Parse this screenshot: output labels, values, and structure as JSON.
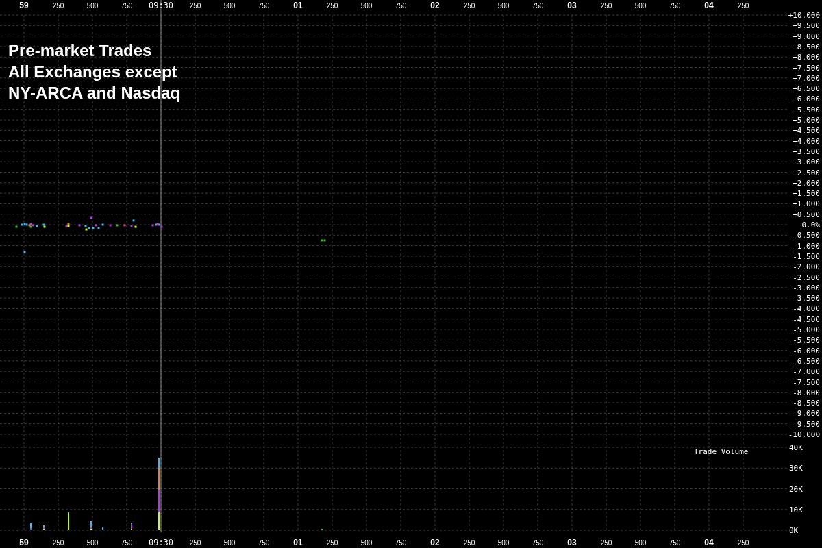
{
  "caption": [
    "Pre-market Trades",
    "All Exchanges except",
    "NY-ARCA and Nasdaq"
  ],
  "price_chart": {
    "time_labels": [
      "59",
      "09:30",
      "250",
      "500",
      "750",
      "01",
      "250",
      "500",
      "750",
      "02",
      "250",
      "500",
      "750",
      "03",
      "250",
      "500",
      "750",
      "04",
      "250"
    ],
    "chart_data": {
      "type": "scatter",
      "grid": true,
      "xlim": [
        -175,
        5575
      ],
      "ylim": [
        -10,
        10
      ],
      "xticks": [
        250,
        500,
        750
      ],
      "yticks": [
        {
          "value": 10,
          "label": "+10.000"
        },
        {
          "value": 9.5,
          "label": "+9.500"
        },
        {
          "value": 9,
          "label": "+9.000"
        },
        {
          "value": 8.5,
          "label": "+8.500"
        },
        {
          "value": 8,
          "label": "+8.000"
        },
        {
          "value": 7.5,
          "label": "+7.500"
        },
        {
          "value": 7,
          "label": "+7.000"
        },
        {
          "value": 6.5,
          "label": "+6.500"
        },
        {
          "value": 6,
          "label": "+6.000"
        },
        {
          "value": 5.5,
          "label": "+5.500"
        },
        {
          "value": 5,
          "label": "+5.000"
        },
        {
          "value": 4.5,
          "label": "+4.500"
        },
        {
          "value": 4,
          "label": "+4.000"
        },
        {
          "value": 3.5,
          "label": "+3.500"
        },
        {
          "value": 3,
          "label": "+3.000"
        },
        {
          "value": 2.5,
          "label": "+2.500"
        },
        {
          "value": 2,
          "label": "+2.000"
        },
        {
          "value": 1.5,
          "label": "+1.500"
        },
        {
          "value": 1,
          "label": "+1.000"
        },
        {
          "value": 0.5,
          "label": "+0.500"
        },
        {
          "value": 0,
          "label": "0.0%"
        },
        {
          "value": -0.5,
          "label": "-0.500"
        },
        {
          "value": -1,
          "label": "-1.000"
        },
        {
          "value": -1.5,
          "label": "-1.500"
        },
        {
          "value": -2,
          "label": "-2.000"
        },
        {
          "value": -2.5,
          "label": "-2.500"
        },
        {
          "value": -3,
          "label": "-3.000"
        },
        {
          "value": -3.5,
          "label": "-3.500"
        },
        {
          "value": -4,
          "label": "-4.000"
        },
        {
          "value": -4.5,
          "label": "-4.500"
        },
        {
          "value": -5,
          "label": "-5.000"
        },
        {
          "value": -5.5,
          "label": "-5.500"
        },
        {
          "value": -6,
          "label": "-6.000"
        },
        {
          "value": -6.5,
          "label": "-6.500"
        },
        {
          "value": -7,
          "label": "-7.000"
        },
        {
          "value": -7.5,
          "label": "-7.500"
        },
        {
          "value": -8,
          "label": "-8.000"
        },
        {
          "value": -8.5,
          "label": "-8.500"
        },
        {
          "value": -9,
          "label": "-9.000"
        },
        {
          "value": -9.5,
          "label": "-9.500"
        },
        {
          "value": -10,
          "label": "-10.000"
        }
      ],
      "series": [
        {
          "color": "#33bbee",
          "x": [
            -15,
            5,
            20,
            95,
            145,
            450,
            475,
            505,
            545,
            575,
            800,
            965,
            985,
            5
          ],
          "values": [
            0,
            0.03,
            0,
            -0.07,
            0,
            -0.07,
            -0.16,
            -0.16,
            -0.16,
            0,
            0.2,
            0,
            0,
            -1.31
          ]
        },
        {
          "color": "#bb33ee",
          "x": [
            50,
            65,
            310,
            405,
            490,
            525,
            630,
            785,
            940,
            1005
          ],
          "values": [
            0.03,
            -0.03,
            -0.07,
            -0.03,
            0.33,
            -0.03,
            -0.03,
            -0.07,
            -0.03,
            -0.1
          ]
        },
        {
          "color": "#ccff00",
          "x": [
            150,
            325,
            455,
            815
          ],
          "values": [
            -0.1,
            -0.07,
            -0.23,
            -0.1
          ]
        },
        {
          "color": "#22cc22",
          "x": [
            -55,
            50,
            680,
            2175,
            2195
          ],
          "values": [
            -0.1,
            -0.1,
            -0.03,
            -0.75,
            -0.75
          ]
        },
        {
          "color": "#dd8822",
          "x": [
            40,
            325
          ],
          "values": [
            -0.03,
            0.03
          ]
        },
        {
          "color": "#ee3399",
          "x": [
            735,
            975
          ],
          "values": [
            -0.03,
            0.03
          ]
        }
      ],
      "ref_lines": [
        {
          "axis": "x",
          "value": 1000,
          "color": "#888888"
        }
      ]
    }
  },
  "volume_chart": {
    "time_labels": [
      "59",
      "09:30",
      "250",
      "500",
      "750",
      "01",
      "250",
      "500",
      "750",
      "02",
      "250",
      "500",
      "750",
      "03",
      "250",
      "500",
      "750",
      "04",
      "250"
    ],
    "chart_data": {
      "type": "bar",
      "title": "Trade Volume",
      "stacked": true,
      "grid": true,
      "xlim": [
        -175,
        5575
      ],
      "ylim": [
        0,
        40000
      ],
      "xticks": [
        250,
        500,
        750
      ],
      "x": [
        -50,
        50,
        145,
        325,
        490,
        575,
        785,
        985,
        2175
      ],
      "yticks": [
        {
          "value": 40000,
          "label": "40K"
        },
        {
          "value": 30000,
          "label": "30K"
        },
        {
          "value": 20000,
          "label": "20K"
        },
        {
          "value": 10000,
          "label": "10K"
        },
        {
          "value": 0,
          "label": "0K"
        }
      ],
      "series": [
        {
          "color": "#ccff00",
          "values": [
            null,
            400,
            600,
            8400,
            800,
            null,
            500,
            8600,
            null
          ]
        },
        {
          "color": "#bb33ee",
          "values": [
            null,
            800,
            1000,
            null,
            500,
            null,
            2200,
            10900,
            null
          ]
        },
        {
          "color": "#dd8822",
          "values": [
            null,
            null,
            null,
            null,
            null,
            null,
            null,
            10200,
            null
          ]
        },
        {
          "color": "#33bbee",
          "values": [
            null,
            2500,
            500,
            300,
            3000,
            1500,
            600,
            5300,
            null
          ]
        },
        {
          "color": "#22cc22",
          "values": [
            300,
            null,
            null,
            null,
            null,
            null,
            null,
            null,
            500
          ]
        }
      ],
      "ref_lines": [
        {
          "axis": "x",
          "value": 1000,
          "color": "#888888"
        }
      ]
    }
  }
}
